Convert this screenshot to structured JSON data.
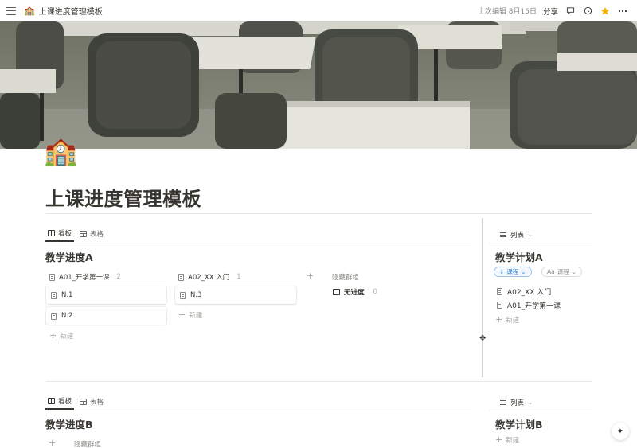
{
  "topbar": {
    "page_icon": "school-emoji",
    "page_name": "上课进度管理模板",
    "last_edited": "上次编辑 8月15日",
    "share_label": "分享",
    "icons": [
      "comment-icon",
      "clock-icon",
      "star-icon",
      "more-icon"
    ],
    "star_color": "#f5b400"
  },
  "page": {
    "icon_glyph": "🏫",
    "title": "上课进度管理模板"
  },
  "section_a": {
    "tabs": [
      {
        "label": "看板",
        "active": true
      },
      {
        "label": "表格",
        "active": false
      }
    ],
    "board_title": "教学进度A",
    "groups": [
      {
        "name": "A01_开学第一课",
        "count": "2",
        "cards": [
          "N.1",
          "N.2"
        ],
        "new_label": "新建"
      },
      {
        "name": "A02_XX 入门",
        "count": "1",
        "cards": [
          "N.3"
        ],
        "new_label": "新建"
      }
    ],
    "add_group": "+",
    "hidden_groups_label": "隐藏群组",
    "hidden_group": {
      "name": "无进度",
      "count": "0"
    },
    "list_view_label": "列表",
    "list_title": "教学计划A",
    "sort_pill": "课程",
    "property_pill": "课程",
    "list_items": [
      "A02_XX 入门",
      "A01_开学第一课"
    ],
    "list_new": "新建"
  },
  "section_b": {
    "tabs": [
      {
        "label": "看板",
        "active": true
      },
      {
        "label": "表格",
        "active": false
      }
    ],
    "board_title": "教学进度B",
    "add_group": "+",
    "hidden_groups_label": "隐藏群组",
    "list_view_label": "列表",
    "list_title": "教学计划B",
    "list_new": "新建"
  },
  "colors": {
    "accent_blue": "#2f7ccf",
    "text": "#37352f",
    "muted": "#8a8985"
  }
}
